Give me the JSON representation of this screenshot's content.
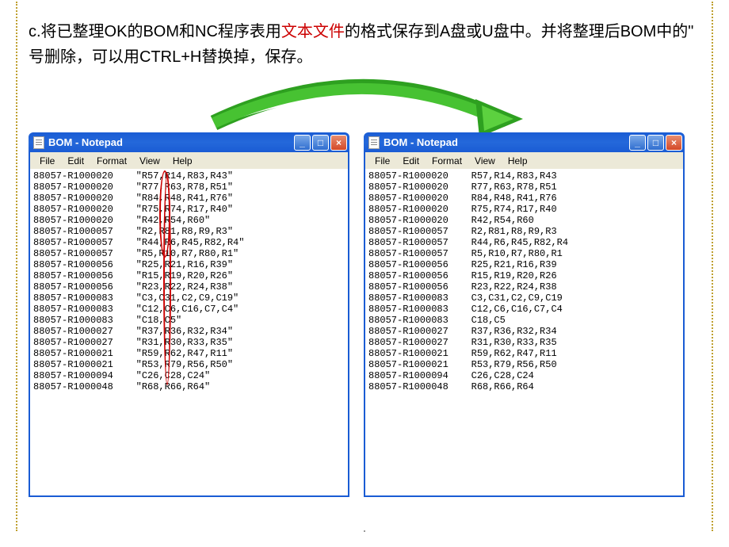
{
  "instruction": {
    "prefix": "c.将已整理OK的BOM和NC程序表用",
    "red": "文本文件",
    "suffix": "的格式保存到A盘或U盘中。并将整理后BOM中的\" 号删除，可以用CTRL+H替换掉，保存。"
  },
  "window": {
    "title": "BOM - Notepad",
    "menus": [
      "File",
      "Edit",
      "Format",
      "View",
      "Help"
    ]
  },
  "left_rows": [
    {
      "pn": "88057-R1000020",
      "refs": "\"R57,R14,R83,R43\""
    },
    {
      "pn": "88057-R1000020",
      "refs": "\"R77,R63,R78,R51\""
    },
    {
      "pn": "88057-R1000020",
      "refs": "\"R84,R48,R41,R76\""
    },
    {
      "pn": "88057-R1000020",
      "refs": "\"R75,R74,R17,R40\""
    },
    {
      "pn": "88057-R1000020",
      "refs": "\"R42,R54,R60\""
    },
    {
      "pn": "88057-R1000057",
      "refs": "\"R2,R81,R8,R9,R3\""
    },
    {
      "pn": "88057-R1000057",
      "refs": "\"R44,R6,R45,R82,R4\""
    },
    {
      "pn": "88057-R1000057",
      "refs": "\"R5,R10,R7,R80,R1\""
    },
    {
      "pn": "88057-R1000056",
      "refs": "\"R25,R21,R16,R39\""
    },
    {
      "pn": "88057-R1000056",
      "refs": "\"R15,R19,R20,R26\""
    },
    {
      "pn": "88057-R1000056",
      "refs": "\"R23,R22,R24,R38\""
    },
    {
      "pn": "88057-R1000083",
      "refs": "\"C3,C31,C2,C9,C19\""
    },
    {
      "pn": "88057-R1000083",
      "refs": "\"C12,C6,C16,C7,C4\""
    },
    {
      "pn": "88057-R1000083",
      "refs": "\"C18,C5\""
    },
    {
      "pn": "88057-R1000027",
      "refs": "\"R37,R36,R32,R34\""
    },
    {
      "pn": "88057-R1000027",
      "refs": "\"R31,R30,R33,R35\""
    },
    {
      "pn": "88057-R1000021",
      "refs": "\"R59,R62,R47,R11\""
    },
    {
      "pn": "88057-R1000021",
      "refs": "\"R53,R79,R56,R50\""
    },
    {
      "pn": "88057-R1000094",
      "refs": "\"C26,C28,C24\""
    },
    {
      "pn": "88057-R1000048",
      "refs": "\"R68,R66,R64\""
    }
  ],
  "right_rows": [
    {
      "pn": "88057-R1000020",
      "refs": "R57,R14,R83,R43"
    },
    {
      "pn": "88057-R1000020",
      "refs": "R77,R63,R78,R51"
    },
    {
      "pn": "88057-R1000020",
      "refs": "R84,R48,R41,R76"
    },
    {
      "pn": "88057-R1000020",
      "refs": "R75,R74,R17,R40"
    },
    {
      "pn": "88057-R1000020",
      "refs": "R42,R54,R60"
    },
    {
      "pn": "88057-R1000057",
      "refs": "R2,R81,R8,R9,R3"
    },
    {
      "pn": "88057-R1000057",
      "refs": "R44,R6,R45,R82,R4"
    },
    {
      "pn": "88057-R1000057",
      "refs": "R5,R10,R7,R80,R1"
    },
    {
      "pn": "88057-R1000056",
      "refs": "R25,R21,R16,R39"
    },
    {
      "pn": "88057-R1000056",
      "refs": "R15,R19,R20,R26"
    },
    {
      "pn": "88057-R1000056",
      "refs": "R23,R22,R24,R38"
    },
    {
      "pn": "88057-R1000083",
      "refs": "C3,C31,C2,C9,C19"
    },
    {
      "pn": "88057-R1000083",
      "refs": "C12,C6,C16,C7,C4"
    },
    {
      "pn": "88057-R1000083",
      "refs": "C18,C5"
    },
    {
      "pn": "88057-R1000027",
      "refs": "R37,R36,R32,R34"
    },
    {
      "pn": "88057-R1000027",
      "refs": "R31,R30,R33,R35"
    },
    {
      "pn": "88057-R1000021",
      "refs": "R59,R62,R47,R11"
    },
    {
      "pn": "88057-R1000021",
      "refs": "R53,R79,R56,R50"
    },
    {
      "pn": "88057-R1000094",
      "refs": "C26,C28,C24"
    },
    {
      "pn": "88057-R1000048",
      "refs": "R68,R66,R64"
    }
  ]
}
